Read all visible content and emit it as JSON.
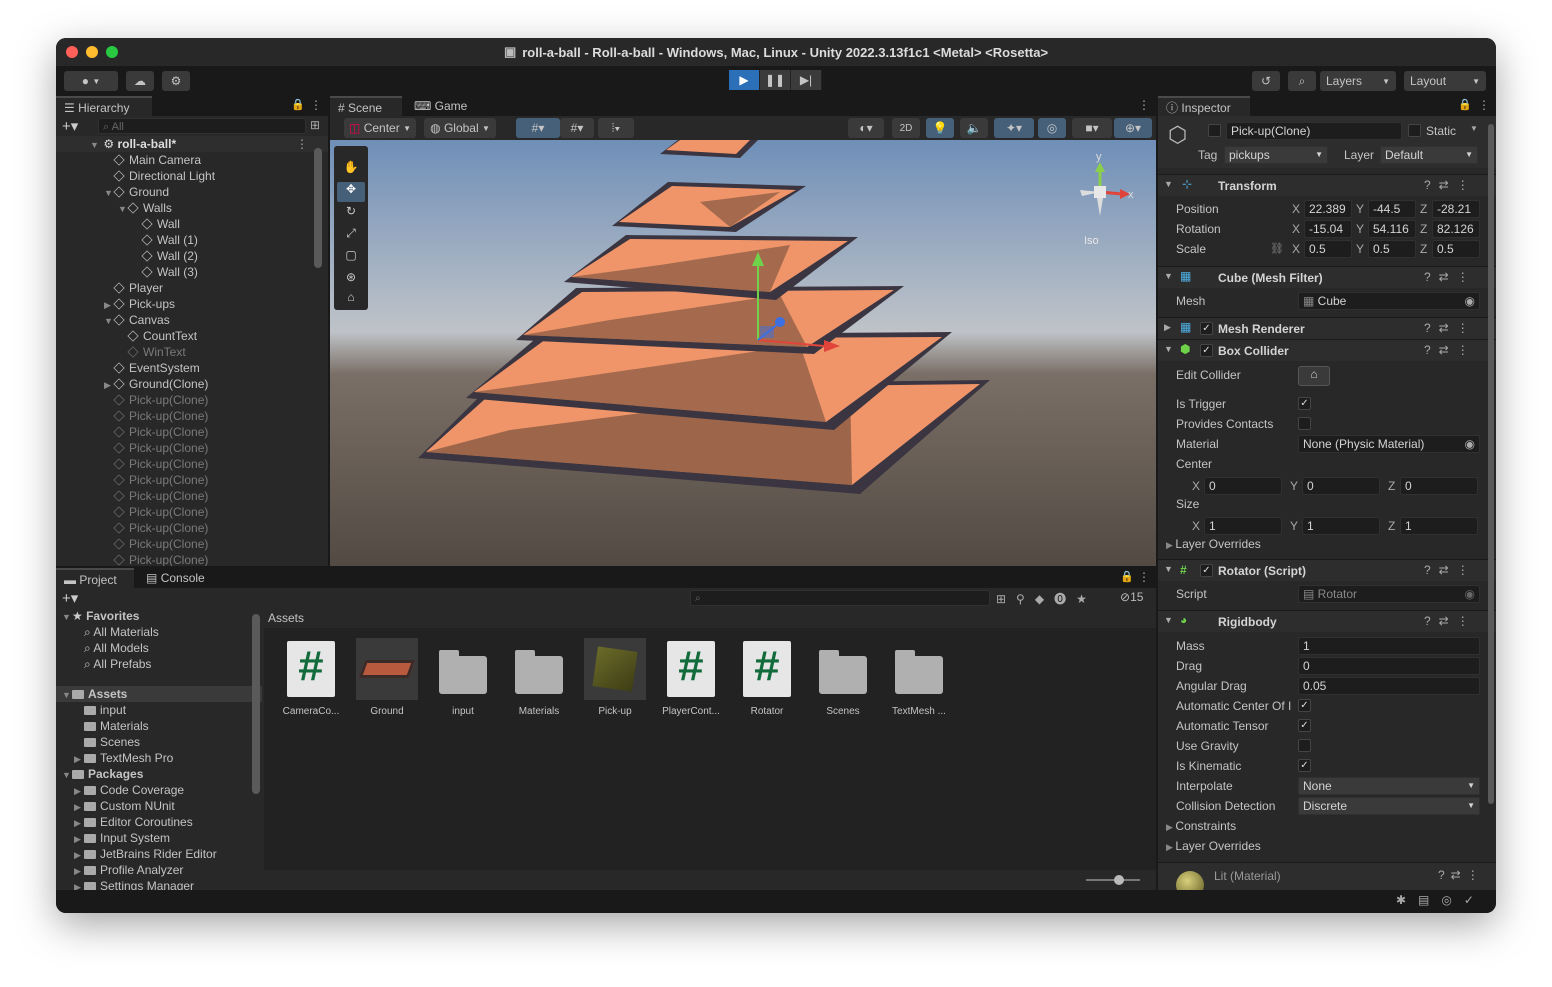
{
  "window": {
    "title": "roll-a-ball - Roll-a-ball - Windows, Mac, Linux - Unity 2022.3.13f1c1 <Metal> <Rosetta>"
  },
  "toolbar": {
    "layers_label": "Layers",
    "layout_label": "Layout"
  },
  "hierarchy": {
    "tab": "Hierarchy",
    "search_placeholder": "All",
    "scene_name": "roll-a-ball*",
    "items": [
      {
        "label": "Main Camera",
        "indent": 1,
        "arrow": "",
        "dim": false
      },
      {
        "label": "Directional Light",
        "indent": 1,
        "arrow": "",
        "dim": false
      },
      {
        "label": "Ground",
        "indent": 1,
        "arrow": "▼",
        "dim": false
      },
      {
        "label": "Walls",
        "indent": 2,
        "arrow": "▼",
        "dim": false
      },
      {
        "label": "Wall",
        "indent": 3,
        "arrow": "",
        "dim": false
      },
      {
        "label": "Wall (1)",
        "indent": 3,
        "arrow": "",
        "dim": false
      },
      {
        "label": "Wall (2)",
        "indent": 3,
        "arrow": "",
        "dim": false
      },
      {
        "label": "Wall (3)",
        "indent": 3,
        "arrow": "",
        "dim": false
      },
      {
        "label": "Player",
        "indent": 1,
        "arrow": "",
        "dim": false
      },
      {
        "label": "Pick-ups",
        "indent": 1,
        "arrow": "▶",
        "dim": false
      },
      {
        "label": "Canvas",
        "indent": 1,
        "arrow": "▼",
        "dim": false
      },
      {
        "label": "CountText",
        "indent": 2,
        "arrow": "",
        "dim": false
      },
      {
        "label": "WinText",
        "indent": 2,
        "arrow": "",
        "dim": true
      },
      {
        "label": "EventSystem",
        "indent": 1,
        "arrow": "",
        "dim": false
      },
      {
        "label": "Ground(Clone)",
        "indent": 1,
        "arrow": "▶",
        "dim": false
      },
      {
        "label": "Pick-up(Clone)",
        "indent": 1,
        "arrow": "",
        "dim": true
      },
      {
        "label": "Pick-up(Clone)",
        "indent": 1,
        "arrow": "",
        "dim": true
      },
      {
        "label": "Pick-up(Clone)",
        "indent": 1,
        "arrow": "",
        "dim": true
      },
      {
        "label": "Pick-up(Clone)",
        "indent": 1,
        "arrow": "",
        "dim": true
      },
      {
        "label": "Pick-up(Clone)",
        "indent": 1,
        "arrow": "",
        "dim": true
      },
      {
        "label": "Pick-up(Clone)",
        "indent": 1,
        "arrow": "",
        "dim": true
      },
      {
        "label": "Pick-up(Clone)",
        "indent": 1,
        "arrow": "",
        "dim": true
      },
      {
        "label": "Pick-up(Clone)",
        "indent": 1,
        "arrow": "",
        "dim": true
      },
      {
        "label": "Pick-up(Clone)",
        "indent": 1,
        "arrow": "",
        "dim": true
      },
      {
        "label": "Pick-up(Clone)",
        "indent": 1,
        "arrow": "",
        "dim": true
      },
      {
        "label": "Pick-up(Clone)",
        "indent": 1,
        "arrow": "",
        "dim": true
      }
    ]
  },
  "scene": {
    "tab_scene": "Scene",
    "tab_game": "Game",
    "pivot": "Center",
    "space": "Global",
    "mode_2d": "2D",
    "iso_label": "Iso",
    "gizmo_y": "y",
    "gizmo_x": "x"
  },
  "project": {
    "tab_project": "Project",
    "tab_console": "Console",
    "hidden_count": "15",
    "favorites_label": "Favorites",
    "favorites": [
      "All Materials",
      "All Models",
      "All Prefabs"
    ],
    "assets_label": "Assets",
    "asset_folders": [
      "input",
      "Materials",
      "Scenes",
      "TextMesh Pro"
    ],
    "packages_label": "Packages",
    "packages": [
      "Code Coverage",
      "Custom NUnit",
      "Editor Coroutines",
      "Input System",
      "JetBrains Rider Editor",
      "Profile Analyzer",
      "Settings Manager"
    ],
    "breadcrumb": "Assets",
    "grid": [
      {
        "name": "CameraCo...",
        "kind": "script"
      },
      {
        "name": "Ground",
        "kind": "prefab-ground"
      },
      {
        "name": "input",
        "kind": "folder"
      },
      {
        "name": "Materials",
        "kind": "folder"
      },
      {
        "name": "Pick-up",
        "kind": "prefab-cube"
      },
      {
        "name": "PlayerCont...",
        "kind": "script"
      },
      {
        "name": "Rotator",
        "kind": "script"
      },
      {
        "name": "Scenes",
        "kind": "folder"
      },
      {
        "name": "TextMesh ...",
        "kind": "folder"
      }
    ]
  },
  "inspector": {
    "tab": "Inspector",
    "object_name": "Pick-up(Clone)",
    "static_label": "Static",
    "tag_label": "Tag",
    "tag_value": "pickups",
    "layer_label": "Layer",
    "layer_value": "Default",
    "transform": {
      "title": "Transform",
      "position_label": "Position",
      "position": [
        "22.389",
        "-44.5",
        "-28.21"
      ],
      "rotation_label": "Rotation",
      "rotation": [
        "-15.04",
        "54.116",
        "82.126"
      ],
      "scale_label": "Scale",
      "scale": [
        "0.5",
        "0.5",
        "0.5"
      ],
      "axes": [
        "X",
        "Y",
        "Z"
      ]
    },
    "mesh_filter": {
      "title": "Cube (Mesh Filter)",
      "mesh_label": "Mesh",
      "mesh_value": "Cube"
    },
    "mesh_renderer": {
      "title": "Mesh Renderer"
    },
    "box_collider": {
      "title": "Box Collider",
      "edit_label": "Edit Collider",
      "is_trigger_label": "Is Trigger",
      "provides_contacts_label": "Provides Contacts",
      "material_label": "Material",
      "material_value": "None (Physic Material)",
      "center_label": "Center",
      "center": [
        "0",
        "0",
        "0"
      ],
      "size_label": "Size",
      "size": [
        "1",
        "1",
        "1"
      ],
      "layer_overrides": "Layer Overrides"
    },
    "rotator": {
      "title": "Rotator (Script)",
      "script_label": "Script",
      "script_value": "Rotator"
    },
    "rigidbody": {
      "title": "Rigidbody",
      "mass_label": "Mass",
      "mass": "1",
      "drag_label": "Drag",
      "drag": "0",
      "angular_drag_label": "Angular Drag",
      "angular_drag": "0.05",
      "auto_center_label": "Automatic Center Of I",
      "auto_tensor_label": "Automatic Tensor",
      "use_gravity_label": "Use Gravity",
      "is_kinematic_label": "Is Kinematic",
      "interpolate_label": "Interpolate",
      "interpolate": "None",
      "collision_label": "Collision Detection",
      "collision": "Discrete",
      "constraints_label": "Constraints",
      "layer_overrides": "Layer Overrides"
    },
    "material": {
      "title": "Lit (Material)"
    }
  },
  "colors": {
    "accent": "#2a6fb8",
    "panel": "#282828",
    "bg": "#191919",
    "floor": "#f0956a"
  }
}
